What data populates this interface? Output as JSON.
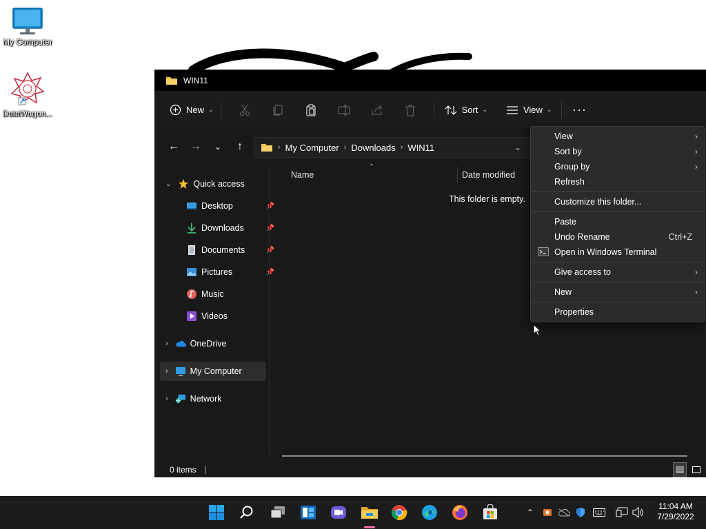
{
  "desktop": {
    "icons": [
      {
        "label": "My Computer"
      },
      {
        "label": "DataWagon..."
      }
    ]
  },
  "window": {
    "title": "WIN11",
    "toolbar": {
      "new_label": "New",
      "sort_label": "Sort",
      "view_label": "View"
    },
    "address": {
      "crumbs": [
        "My Computer",
        "Downloads",
        "WIN11"
      ]
    },
    "sidebar": {
      "quick_access": "Quick access",
      "items": [
        {
          "label": "Desktop",
          "pinned": true
        },
        {
          "label": "Downloads",
          "pinned": true
        },
        {
          "label": "Documents",
          "pinned": true
        },
        {
          "label": "Pictures",
          "pinned": true
        },
        {
          "label": "Music",
          "pinned": false
        },
        {
          "label": "Videos",
          "pinned": false
        }
      ],
      "onedrive": "OneDrive",
      "my_computer": "My Computer",
      "network": "Network"
    },
    "columns": {
      "name": "Name",
      "date_modified": "Date modified"
    },
    "empty_message": "This folder is empty.",
    "status": {
      "items": "0 items"
    }
  },
  "context_menu": {
    "items": [
      {
        "label": "View",
        "submenu": true
      },
      {
        "label": "Sort by",
        "submenu": true
      },
      {
        "label": "Group by",
        "submenu": true
      },
      {
        "label": "Refresh"
      },
      {
        "label": "Customize this folder..."
      },
      {
        "label": "Paste"
      },
      {
        "label": "Undo Rename",
        "shortcut": "Ctrl+Z"
      },
      {
        "label": "Open in Windows Terminal"
      },
      {
        "label": "Give access to",
        "submenu": true
      },
      {
        "label": "New",
        "submenu": true
      },
      {
        "label": "Properties"
      }
    ]
  },
  "taskbar": {
    "clock": {
      "time": "11:04 AM",
      "date": "7/29/2022"
    }
  },
  "colors": {
    "folder": "#f2c14e",
    "accent": "#0078d4",
    "taskbar": "#1c1c1c",
    "window_bg": "#191919"
  }
}
